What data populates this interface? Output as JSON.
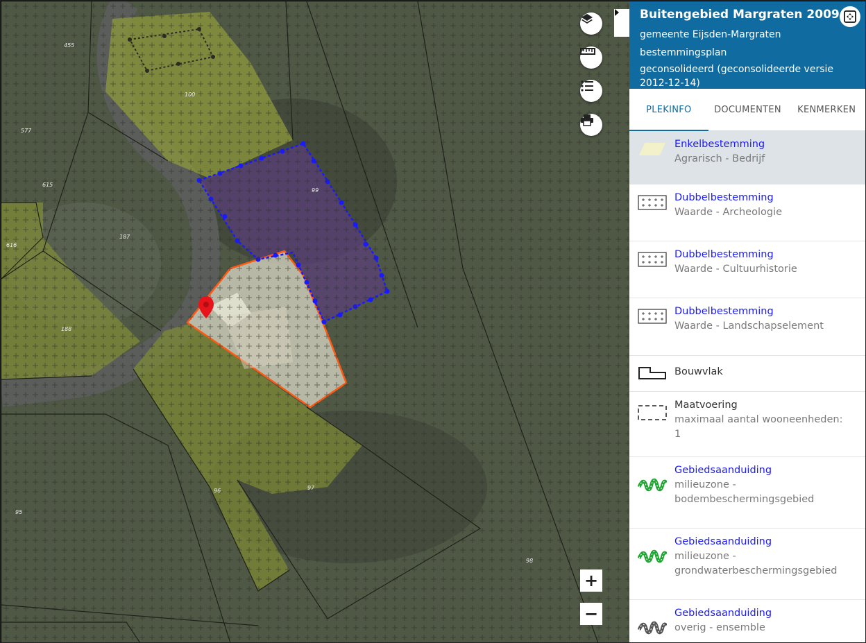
{
  "panel": {
    "title": "Buitengebied Margraten 2009",
    "municipality": "gemeente Eijsden-Margraten",
    "plan_type": "bestemmingsplan",
    "status": "geconsolideerd (geconsolideerde versie 2012-12-14)"
  },
  "tabs": [
    {
      "label": "PLEKINFO",
      "active": true
    },
    {
      "label": "DOCUMENTEN",
      "active": false
    },
    {
      "label": "KENMERKEN",
      "active": false
    }
  ],
  "legend": [
    {
      "title": "Enkelbestemming",
      "subtitle": "Agrarisch - Bedrijf",
      "icon": "agrarisch-swatch-icon"
    },
    {
      "title": "Dubbelbestemming",
      "subtitle": "Waarde - Archeologie",
      "icon": "cross-hatch-icon"
    },
    {
      "title": "Dubbelbestemming",
      "subtitle": "Waarde - Cultuurhistorie",
      "icon": "cross-hatch-icon"
    },
    {
      "title": "Dubbelbestemming",
      "subtitle": "Waarde - Landschapselement",
      "icon": "cross-hatch-icon"
    },
    {
      "title": "Bouwvlak",
      "subtitle": "",
      "icon": "bouwvlak-outline-icon"
    },
    {
      "title": "Maatvoering",
      "subtitle": "maximaal aantal wooneenheden: 1",
      "icon": "dashed-box-icon"
    },
    {
      "title": "Gebiedsaanduiding",
      "subtitle": "milieuzone - bodembeschermingsgebied",
      "icon": "green-zigzag-icon"
    },
    {
      "title": "Gebiedsaanduiding",
      "subtitle": "milieuzone - grondwaterbeschermingsgebied",
      "icon": "green-zigzag-icon"
    },
    {
      "title": "Gebiedsaanduiding",
      "subtitle": "overig - ensemble",
      "icon": "grey-zigzag-icon"
    }
  ],
  "map": {
    "zoom_in": "+",
    "zoom_out": "−",
    "parcel_numbers": [
      "455",
      "100",
      "577",
      "615",
      "187",
      "616",
      "188",
      "99",
      "96",
      "97",
      "95",
      "98"
    ]
  },
  "colors": {
    "header_bg": "#0f6ba0",
    "link_blue": "#1a1aff",
    "agrarisch": "#9aa83a",
    "selected_row": "#dde3e7"
  }
}
